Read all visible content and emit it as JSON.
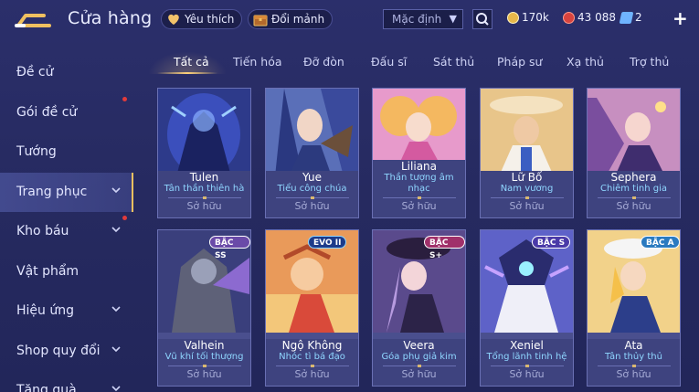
{
  "header": {
    "title": "Cửa hàng",
    "favorites_label": "Yêu thích",
    "exchange_label": "Đổi mảnh",
    "sort_select": "Mặc định",
    "gold": "170k",
    "rubies": "43 088",
    "vouchers": "2"
  },
  "sidebar": {
    "items": [
      {
        "label": "Đề cử"
      },
      {
        "label": "Gói đề cử"
      },
      {
        "label": "Tướng"
      },
      {
        "label": "Trang phục"
      },
      {
        "label": "Kho báu"
      },
      {
        "label": "Vật phẩm"
      },
      {
        "label": "Hiệu ứng"
      },
      {
        "label": "Shop quy đổi"
      },
      {
        "label": "Tặng quà"
      }
    ]
  },
  "tabs": [
    "Tất cả",
    "Tiến hóa",
    "Đỡ đòn",
    "Đấu sĩ",
    "Sát thủ",
    "Pháp sư",
    "Xạ thủ",
    "Trợ thủ"
  ],
  "cards": [
    {
      "name": "Tulen",
      "skin": "Tân thần thiên hà",
      "status": "Sở hữu",
      "badge": ""
    },
    {
      "name": "Yue",
      "skin": "Tiểu công chúa",
      "status": "Sở hữu",
      "badge": ""
    },
    {
      "name": "Liliana",
      "skin": "Thần tượng âm nhạc",
      "status": "Sở hữu",
      "badge": ""
    },
    {
      "name": "Lữ Bố",
      "skin": "Nam vương",
      "status": "Sở hữu",
      "badge": ""
    },
    {
      "name": "Sephera",
      "skin": "Chiêm tinh gia",
      "status": "Sở hữu",
      "badge": ""
    },
    {
      "name": "Valhein",
      "skin": "Vũ khí tối thượng",
      "status": "Sở hữu",
      "badge": "BẬC SS"
    },
    {
      "name": "Ngộ Không",
      "skin": "Nhóc tì bá đạo",
      "status": "Sở hữu",
      "badge": "EVO II"
    },
    {
      "name": "Veera",
      "skin": "Góa phụ giả kim",
      "status": "Sở hữu",
      "badge": "BẬC S+"
    },
    {
      "name": "Xeniel",
      "skin": "Tổng lãnh tinh hệ",
      "status": "Sở hữu",
      "badge": "BẬC S"
    },
    {
      "name": "Ata",
      "skin": "Tân thủy thủ",
      "status": "Sở hữu",
      "badge": "BẬC A"
    }
  ],
  "colors": {
    "background": "#262a60",
    "accent_gold": "#f0c060",
    "skin_name": "#8fd6ff",
    "notification_dot": "#e23b3b"
  }
}
